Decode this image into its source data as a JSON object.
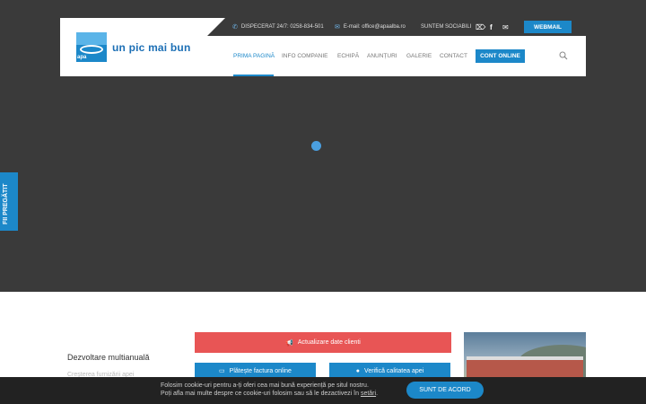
{
  "header": {
    "slogan": "un pic mai bun",
    "logo_text": "apa",
    "dispatch_icon": "phone-icon",
    "dispatch": "DISPECERAT 24/7: 0258-834-501",
    "email_icon": "envelope-icon",
    "email": "E-mail: office@apaalba.ro",
    "social_label": "SUNTEM SOCIABILI",
    "social_icons": [
      "rss-icon",
      "facebook-icon",
      "mail-icon"
    ],
    "webmail": "WEBMAIL"
  },
  "nav": {
    "items": [
      "PRIMA PAGINĂ",
      "INFO COMPANIE",
      "ECHIPĂ",
      "ANUNȚURI",
      "GALERIE",
      "CONTACT"
    ],
    "active": "PRIMA PAGINĂ",
    "cont_online": "CONT ONLINE",
    "search_icon": "search-icon"
  },
  "side_tab": "FII PREGĂTIT",
  "section": {
    "title": "Dezvoltare multianuală",
    "subtitle": "Creşterea furnizării apei"
  },
  "buttons": {
    "update_data": "Actualizare date clienti",
    "update_icon": "megaphone-icon",
    "pay_invoice": "Plătește factura online",
    "pay_icon": "credit-card-icon",
    "water_quality": "Verifică calitatea apei",
    "water_icon": "water-drop-icon"
  },
  "cookie": {
    "line1": "Folosim cookie-uri pentru a-ți oferi cea mai bună experiență pe situl nostru.",
    "line2_prefix": "Poți afla mai multe despre ce cookie-uri folosim sau să le dezactivezi în ",
    "line2_link": "setări",
    "line2_suffix": ".",
    "accept": "SUNT DE ACORD"
  },
  "colors": {
    "brand_blue": "#1c88c9",
    "alert_red": "#e85555",
    "hero_dark": "#3a3a3a"
  }
}
